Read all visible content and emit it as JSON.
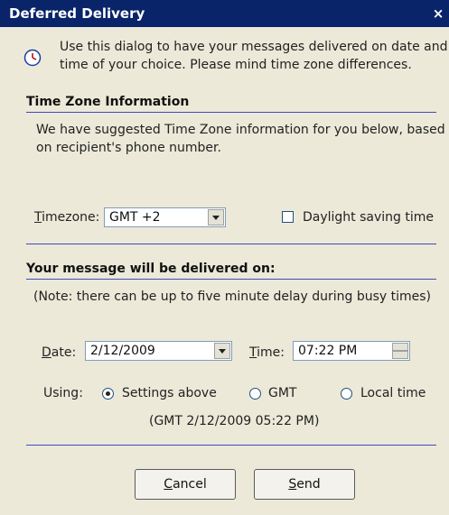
{
  "window": {
    "title": "Deferred Delivery",
    "close_glyph": "×"
  },
  "intro": {
    "icon": "clock-icon",
    "line1": "Use this dialog to have your messages delivered on date and",
    "line2": "time of your choice. Please mind time zone differences."
  },
  "timezone_section": {
    "header": "Time Zone Information",
    "desc_line1": "We have suggested Time Zone information for you below, based",
    "desc_line2": "on recipient's phone number.",
    "timezone_label_ul": "T",
    "timezone_label_rest": "imezone:",
    "timezone_value": "GMT +2",
    "daylight_checked": false,
    "daylight_label": "Daylight saving time"
  },
  "delivery_section": {
    "header": "Your message will be delivered on:",
    "note": "(Note: there can be up to five minute delay during busy times)",
    "date_label_ul": "D",
    "date_label_rest": "ate:",
    "date_value": "2/12/2009",
    "time_label_ul": "T",
    "time_label_rest": "ime:",
    "time_value": "07:22 PM",
    "using_label": "Using:",
    "options": [
      {
        "label": "Settings above",
        "selected": true
      },
      {
        "label": "GMT",
        "selected": false
      },
      {
        "label": "Local time",
        "selected": false
      }
    ],
    "computed_gmt": "(GMT 2/12/2009 05:22 PM)"
  },
  "buttons": {
    "cancel_ul": "C",
    "cancel_rest": "ancel",
    "send_ul": "S",
    "send_rest": "end"
  }
}
